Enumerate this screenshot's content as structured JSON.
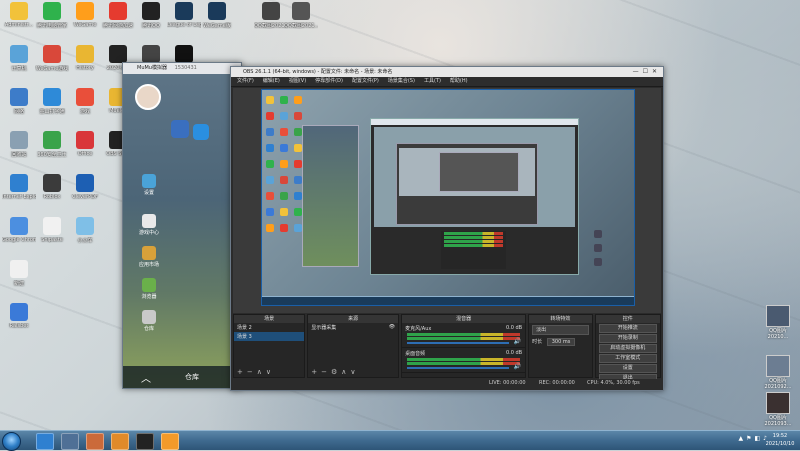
{
  "desktop": {
    "icons": [
      {
        "label": "Administr...",
        "color": "#f2c23a"
      },
      {
        "label": "腾讯电脑管家",
        "color": "#2fb24c"
      },
      {
        "label": "WeGame",
        "color": "#ff9e1b"
      },
      {
        "label": "腾讯网游加速",
        "color": "#e53b2f"
      },
      {
        "label": "腾讯QQ",
        "color": "#222"
      },
      {
        "label": "League of Legends",
        "color": "#1a3a5a"
      },
      {
        "label": "WeGame版",
        "color": "#1a3a5a"
      },
      {
        "label": "计算机",
        "color": "#5aa3d8"
      },
      {
        "label": "WeGame游戏",
        "color": "#d9483a"
      },
      {
        "label": "History",
        "color": "#e9b632"
      },
      {
        "label": "2020-2...",
        "color": "#222"
      },
      {
        "label": "OBS Studio",
        "color": "#444"
      },
      {
        "label": "OBS",
        "color": "#111"
      },
      {
        "label": "网络",
        "color": "#3d7cc9"
      },
      {
        "label": "金山打字通",
        "color": "#2e8ad8"
      },
      {
        "label": "游戏",
        "color": "#e94f3a"
      },
      {
        "label": "Muelec",
        "color": "#e9b632"
      },
      {
        "label": "回收站",
        "color": "#8aa0b2"
      },
      {
        "label": "360安全卫士",
        "color": "#3aa34a"
      },
      {
        "label": "Office",
        "color": "#d9363a"
      },
      {
        "label": "OBS Stud",
        "color": "#222"
      },
      {
        "label": "Internet Explorer",
        "color": "#2f80d0"
      },
      {
        "label": "Roblox",
        "color": "#3b3b3b"
      },
      {
        "label": "CleverPDF",
        "color": "#1d5fb3"
      },
      {
        "label": "Google Chrome",
        "color": "#4c8fe0"
      },
      {
        "label": "Snipaste",
        "color": "#f1f1f1"
      },
      {
        "label": "小火车",
        "color": "#7fbfe7"
      },
      {
        "label": "新建",
        "color": "#f0f0f0"
      },
      {
        "label": "Ralsbet",
        "color": "#3b7ad8"
      }
    ],
    "top_files": [
      {
        "label": "QQ截图2021...",
        "color": "#444"
      },
      {
        "label": "QQ截图2021...",
        "color": "#555"
      }
    ],
    "right_thumbs": [
      {
        "label": "QQ图片",
        "sub": "20210...",
        "color": "#4a5a70"
      },
      {
        "label": "QQ图片",
        "sub": "2021092...",
        "color": "#6c7d92"
      },
      {
        "label": "QQ图片",
        "sub": "2021093...",
        "color": "#3a3030"
      }
    ]
  },
  "mumu": {
    "title": "MuMu模拟器",
    "title_id": "1530431",
    "app_labels": [
      "设置",
      "游戏中心",
      "应用市场",
      "浏览器",
      "仓库"
    ],
    "bottom_label": "仓库"
  },
  "obs": {
    "title": "OBS 26.1.1 (64-bit, windows) - 配置文件: 未命名 - 场景: 未命名",
    "menu": [
      "文件(F)",
      "编辑(E)",
      "视图(V)",
      "停靠部件(D)",
      "配置文件(P)",
      "场景集合(S)",
      "工具(T)",
      "帮助(H)"
    ],
    "docks": {
      "scenes": {
        "header": "场景",
        "items": [
          "场景 2",
          "场景 3"
        ],
        "selected": 1
      },
      "sources": {
        "header": "来源",
        "items": [
          "显示器采集"
        ]
      },
      "mixer": {
        "header": "混音器",
        "channels": [
          {
            "name": "麦克风/Aux",
            "level": "0.0 dB"
          },
          {
            "name": "桌面音频",
            "level": "0.0 dB"
          }
        ]
      },
      "transitions": {
        "header": "转场特效",
        "type": "淡出",
        "duration_label": "时长",
        "duration": "300 ms"
      },
      "controls": {
        "header": "控件",
        "buttons": [
          "开始推流",
          "开始录制",
          "启动虚拟摄像机",
          "工作室模式",
          "设置",
          "退出"
        ]
      }
    },
    "status": {
      "live": "LIVE: 00:00:00",
      "rec": "REC: 00:00:00",
      "cpu": "CPU: 4.0%, 30.00 fps"
    }
  },
  "taskbar": {
    "time": "19:52",
    "date": "2021/10/10",
    "items": [
      {
        "name": "kugou",
        "color": "#2f80d0"
      },
      {
        "name": "file-explorer",
        "color": "#4f7096"
      },
      {
        "name": "mumu",
        "color": "#cb6a3a"
      },
      {
        "name": "game",
        "color": "#e08a2a"
      },
      {
        "name": "obs",
        "color": "#222"
      },
      {
        "name": "wegame",
        "color": "#f29a2a"
      }
    ]
  }
}
